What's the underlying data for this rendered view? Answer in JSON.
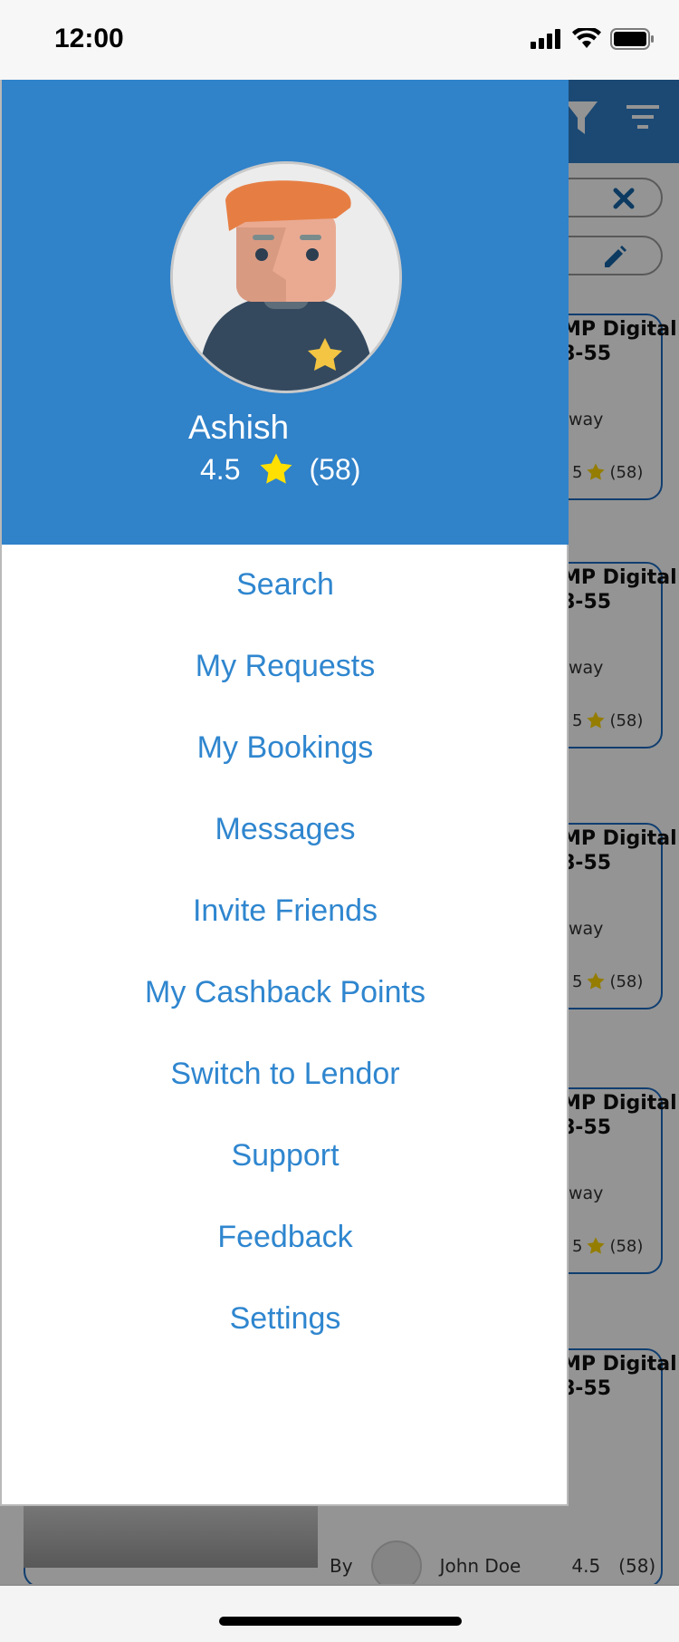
{
  "status_bar": {
    "time": "12:00"
  },
  "drawer": {
    "user": {
      "name": "Ashish",
      "rating": "4.5",
      "review_count": "(58)"
    },
    "menu_items": [
      "Search",
      "My Requests",
      "My Bookings",
      "Messages",
      "Invite Friends",
      "My Cashback Points",
      "Switch to Lendor",
      "Support",
      "Feedback",
      "Settings"
    ]
  },
  "background": {
    "cards": [
      {
        "title_line1": "MP Digital",
        "title_line2": "8-55",
        "subtitle": "way",
        "rating": "5",
        "count": "(58)"
      },
      {
        "title_line1": "MP Digital",
        "title_line2": "8-55",
        "subtitle": "way",
        "rating": "5",
        "count": "(58)"
      },
      {
        "title_line1": "MP Digital",
        "title_line2": "8-55",
        "subtitle": "way",
        "rating": "5",
        "count": "(58)"
      },
      {
        "title_line1": "MP Digital",
        "title_line2": "8-55",
        "subtitle": "way",
        "rating": "5",
        "count": "(58)"
      },
      {
        "title_line1": "MP Digital",
        "title_line2": "8-55",
        "subtitle": "",
        "rating": "",
        "count": ""
      }
    ],
    "bottom_card": {
      "by_label": "By",
      "owner": "John Doe",
      "rating": "4.5",
      "count": "(58)"
    }
  },
  "colors": {
    "primary": "#3082c9",
    "menu_text": "#2f86cf",
    "star": "#ffd700"
  }
}
